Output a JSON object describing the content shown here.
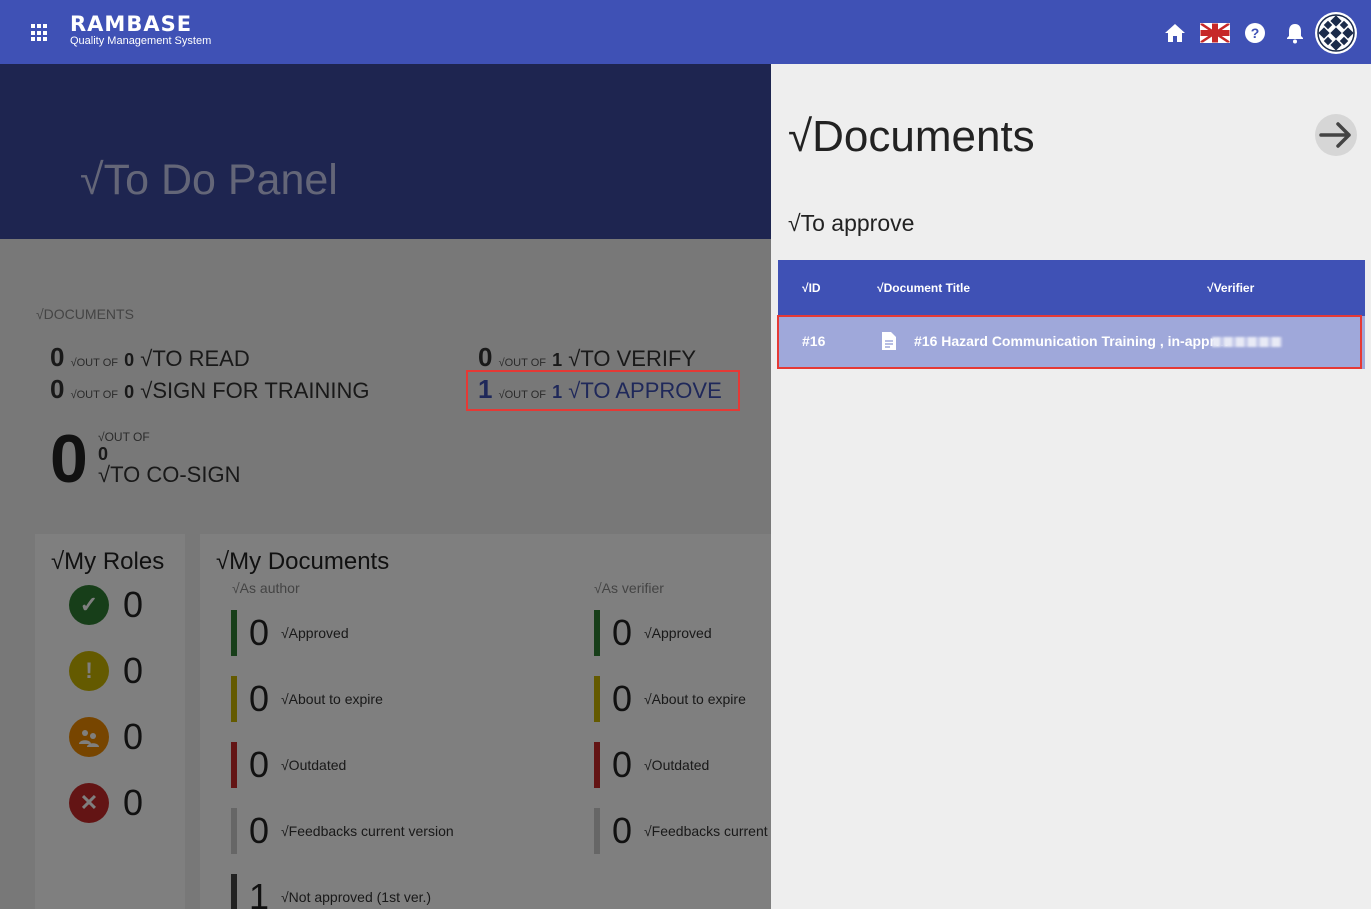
{
  "header": {
    "brand_name": "RAMBASE",
    "brand_sub": "Quality Management System",
    "icons": [
      "apps-icon",
      "home-icon",
      "uk-flag-icon",
      "help-icon",
      "bell-icon",
      "avatar"
    ]
  },
  "main": {
    "title": "√To Do Panel",
    "documents_label": "√DOCUMENTS",
    "stats": {
      "to_read": {
        "count": "0",
        "of": "√OUT OF",
        "total": "0",
        "label": "√TO READ"
      },
      "sign_training": {
        "count": "0",
        "of": "√OUT OF",
        "total": "0",
        "label": "√SIGN FOR TRAINING"
      },
      "to_verify": {
        "count": "0",
        "of": "√OUT OF",
        "total": "1",
        "label": "√TO VERIFY"
      },
      "to_approve": {
        "count": "1",
        "of": "√OUT OF",
        "total": "1",
        "label": "√TO APPROVE"
      },
      "to_cosign": {
        "count": "0",
        "of": "√OUT OF",
        "total": "0",
        "label": "√TO CO-SIGN"
      }
    },
    "roles": {
      "title": "√My Roles",
      "items": [
        {
          "icon": "check-circle-icon",
          "count": "0",
          "color": "#2e7d32"
        },
        {
          "icon": "exclamation-circle-icon",
          "count": "0",
          "color": "#c9b400"
        },
        {
          "icon": "group-icon",
          "count": "0",
          "color": "#ef8a00"
        },
        {
          "icon": "cancel-circle-icon",
          "count": "0",
          "color": "#c62828"
        }
      ]
    },
    "my_documents": {
      "title": "√My Documents",
      "as_author": "√As author",
      "as_verifier": "√As verifier",
      "author_items": [
        {
          "count": "0",
          "label": "√Approved",
          "color": "#2e7d32"
        },
        {
          "count": "0",
          "label": "√About to expire",
          "color": "#c9b400"
        },
        {
          "count": "0",
          "label": "√Outdated",
          "color": "#c62828"
        },
        {
          "count": "0",
          "label": "√Feedbacks current version",
          "color": "#cccccc"
        },
        {
          "count": "1",
          "label": "√Not approved (1st ver.)",
          "color": "#444444"
        }
      ],
      "verifier_items": [
        {
          "count": "0",
          "label": "√Approved",
          "color": "#2e7d32"
        },
        {
          "count": "0",
          "label": "√About to expire",
          "color": "#c9b400"
        },
        {
          "count": "0",
          "label": "√Outdated",
          "color": "#c62828"
        },
        {
          "count": "0",
          "label": "√Feedbacks current",
          "color": "#cccccc"
        }
      ]
    }
  },
  "panel": {
    "title": "√Documents",
    "subtitle": "√To approve",
    "columns": {
      "id": "√ID",
      "title": "√Document Title",
      "verifier": "√Verifier"
    },
    "rows": [
      {
        "id": "#16",
        "title": "#16 Hazard Communication Training , in-appr…"
      }
    ]
  }
}
